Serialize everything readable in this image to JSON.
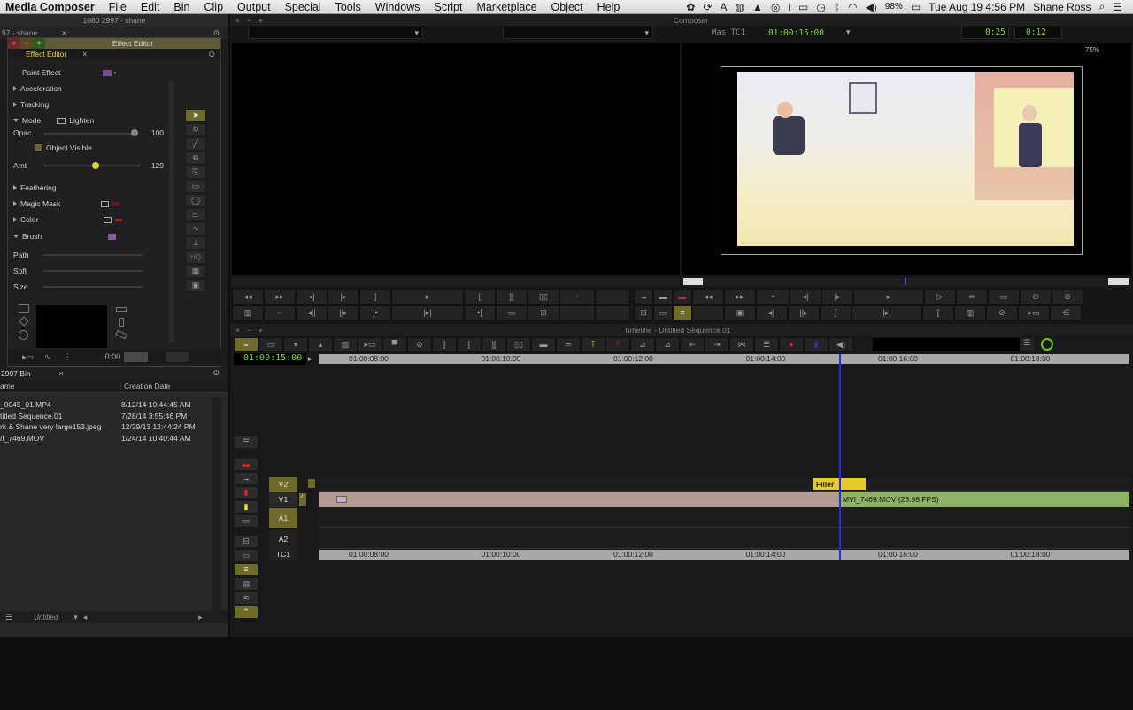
{
  "menubar": {
    "app": "Media Composer",
    "items": [
      "File",
      "Edit",
      "Bin",
      "Clip",
      "Output",
      "Special",
      "Tools",
      "Windows",
      "Script",
      "Marketplace",
      "Object",
      "Help"
    ],
    "battery": "98%",
    "datetime": "Tue Aug 19  4:56 PM",
    "user": "Shane Ross"
  },
  "project": {
    "title": "1080 2997 - shane",
    "tab": "97 - shane"
  },
  "effect_editor": {
    "window_title": "Effect Editor",
    "tab": "Effect Editor",
    "effect": "Paint Effect",
    "params": {
      "acceleration": "Acceleration",
      "tracking": "Tracking",
      "mode": "Mode",
      "mode_value": "Lighten",
      "opac_label": "Opac.",
      "opac_value": "100",
      "object_visible": "Object Visible",
      "amt_label": "Amt",
      "amt_value": "129",
      "amt_level": 0.5,
      "feathering": "Feathering",
      "magic_mask": "Magic Mask",
      "color": "Color",
      "brush": "Brush",
      "path": "Path",
      "soft": "Soft",
      "size": "Size"
    },
    "timecode": "0:00",
    "tools": [
      "pointer",
      "rotate",
      "line",
      "copy",
      "paste",
      "rectangle",
      "oval",
      "polygon",
      "curve",
      "stamp",
      "HQ",
      "grid",
      "frame"
    ]
  },
  "bin": {
    "tab": "2997 Bin",
    "columns": [
      "ame",
      "Creation Date"
    ],
    "rows": [
      {
        "name": "_0045_01.MP4",
        "date": "8/12/14 10:44:45 AM"
      },
      {
        "name": "titled Sequence.01",
        "date": "7/28/14 3:55:46 PM"
      },
      {
        "name": "rk & Shane very large153.jpeg",
        "date": "12/29/13 12:44:24 PM"
      },
      {
        "name": "/I_7469.MOV",
        "date": "1/24/14 10:40:44 AM"
      }
    ],
    "footer": "Untitled"
  },
  "composer": {
    "title": "Composer",
    "tc_label": "Mas  TC1",
    "tc_value": "01:00:15:00",
    "dur1": "0:25",
    "dur2": "0:12",
    "zoom": "75%"
  },
  "timeline": {
    "title": "Timeline - Untitled Sequence.01",
    "position": "01:00:15:00",
    "ruler": [
      "01:00:08:00",
      "01:00:10:00",
      "01:00:12:00",
      "01:00:14:00",
      "01:00:16:00",
      "01:00:18:00"
    ],
    "tracks": [
      "V2",
      "V1",
      "A1",
      "A2",
      "TC1"
    ],
    "filler": "Filler",
    "clip": "MVI_7469.MOV (23.98 FPS)"
  }
}
